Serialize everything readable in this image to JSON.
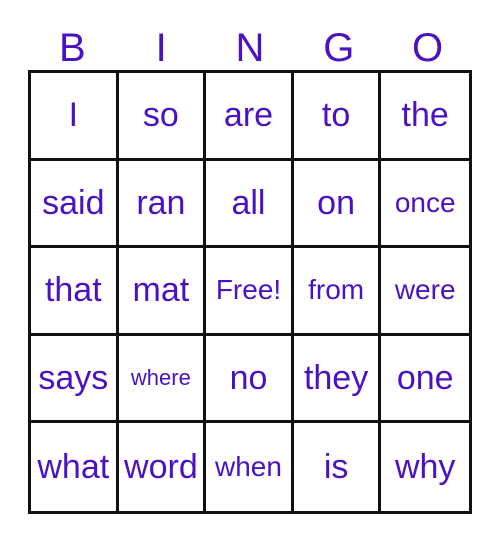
{
  "card": {
    "title": "BINGO",
    "text_color": "#4a12c4",
    "grid_line_color": "#111111",
    "background_color": "#ffffff",
    "headers": [
      {
        "label": "B"
      },
      {
        "label": "I"
      },
      {
        "label": "N"
      },
      {
        "label": "G"
      },
      {
        "label": "O"
      }
    ],
    "rows": [
      {
        "cells": [
          {
            "label": "I",
            "size": "normal",
            "free": false
          },
          {
            "label": "so",
            "size": "normal",
            "free": false
          },
          {
            "label": "are",
            "size": "normal",
            "free": false
          },
          {
            "label": "to",
            "size": "normal",
            "free": false
          },
          {
            "label": "the",
            "size": "normal",
            "free": false
          }
        ]
      },
      {
        "cells": [
          {
            "label": "said",
            "size": "normal",
            "free": false
          },
          {
            "label": "ran",
            "size": "normal",
            "free": false
          },
          {
            "label": "all",
            "size": "normal",
            "free": false
          },
          {
            "label": "on",
            "size": "normal",
            "free": false
          },
          {
            "label": "once",
            "size": "small",
            "free": false
          }
        ]
      },
      {
        "cells": [
          {
            "label": "that",
            "size": "normal",
            "free": false
          },
          {
            "label": "mat",
            "size": "normal",
            "free": false
          },
          {
            "label": "Free!",
            "size": "small",
            "free": true
          },
          {
            "label": "from",
            "size": "small",
            "free": false
          },
          {
            "label": "were",
            "size": "small",
            "free": false
          }
        ]
      },
      {
        "cells": [
          {
            "label": "says",
            "size": "normal",
            "free": false
          },
          {
            "label": "where",
            "size": "xsmall",
            "free": false
          },
          {
            "label": "no",
            "size": "normal",
            "free": false
          },
          {
            "label": "they",
            "size": "normal",
            "free": false
          },
          {
            "label": "one",
            "size": "normal",
            "free": false
          }
        ]
      },
      {
        "cells": [
          {
            "label": "what",
            "size": "normal",
            "free": false
          },
          {
            "label": "word",
            "size": "normal",
            "free": false
          },
          {
            "label": "when",
            "size": "small",
            "free": false
          },
          {
            "label": "is",
            "size": "normal",
            "free": false
          },
          {
            "label": "why",
            "size": "normal",
            "free": false
          }
        ]
      }
    ]
  }
}
